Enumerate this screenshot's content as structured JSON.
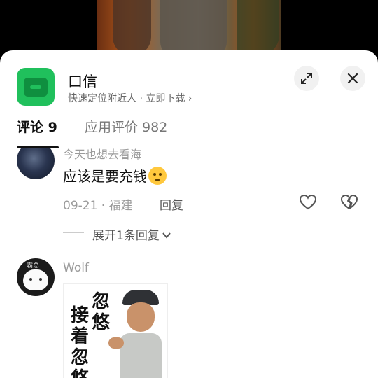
{
  "app": {
    "name": "口信",
    "subtitle": "快速定位附近人 · 立即下载 ›"
  },
  "tabs": [
    {
      "label": "评论 9",
      "active": true
    },
    {
      "label": "应用评价 982",
      "active": false
    }
  ],
  "comments": [
    {
      "partial_text": "今天也想去看海",
      "text": "应该是要充钱",
      "meta": "09-21 · 福建",
      "reply_label": "回复",
      "expand_label": "展开1条回复"
    },
    {
      "user": "Wolf",
      "meme_text_col1": "忽悠",
      "meme_text_col2": "接着忽悠",
      "avatar_text": "霸总"
    }
  ],
  "colors": {
    "accent_green": "#20c05c",
    "text_primary": "#111111",
    "text_secondary": "#9a9a9a"
  }
}
